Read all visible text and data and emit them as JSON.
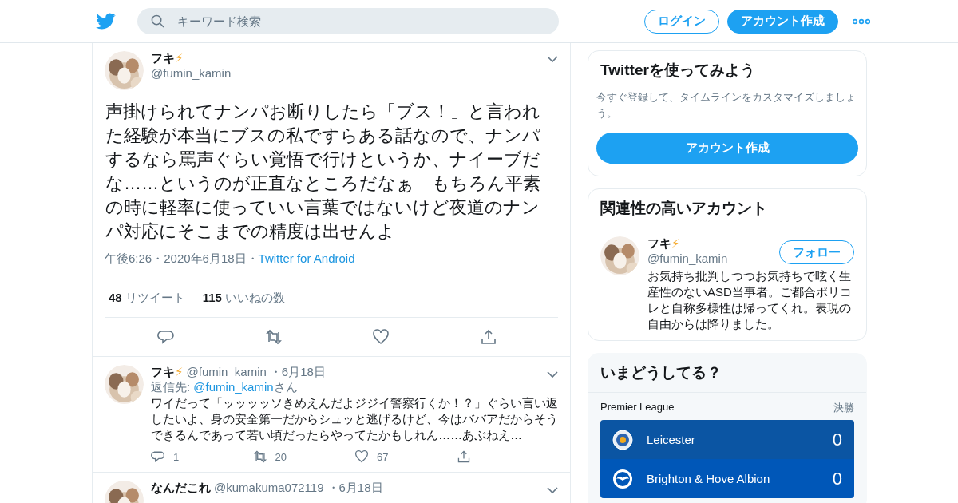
{
  "header": {
    "search": {
      "placeholder": "キーワード検索"
    },
    "buttons": [
      {
        "label": "ログイン",
        "kind": "outline"
      },
      {
        "label": "アカウント作成",
        "kind": "filled"
      }
    ]
  },
  "tweet": {
    "name": "フキ",
    "badge": "⚡",
    "handle": "@fumin_kamin",
    "text": "声掛けられてナンパお断りしたら「ブス！」と言われた経験が本当にブスの私ですらある話なので、ナンパするなら罵声ぐらい覚悟で行けというか、ナイーブだな……というのが正直なところだなぁ　もちろん平素の時に軽率に使っていい言葉ではないけど夜道のナンパ対応にそこまでの精度は出せんよ",
    "meta": [
      {
        "text": "午後6:26",
        "kind": "text",
        "sep": "・"
      },
      {
        "text": "2020年6月18日",
        "kind": "text",
        "sep": "・"
      },
      {
        "text": "Twitter for Android",
        "kind": "link"
      }
    ],
    "stats": [
      {
        "count": "48",
        "label": "リツイート"
      },
      {
        "count": "115",
        "label": "いいねの数"
      }
    ]
  },
  "replies": [
    {
      "name": "フキ",
      "badge": "⚡",
      "handle": "@fumin_kamin",
      "date": "・6月18日",
      "reply_prefix": "返信先:",
      "reply_to": "@fumin_kamin",
      "reply_suffix": "さん",
      "text": "ワイだって「ッッッッソきめえんだよジジイ警察行くか！？」ぐらい言い返したいよ、身の安全第一だからシュッと逃げるけど、今はババアだからそうできるんであって若い頃だったらやってたかもしれん……あぶねえ…",
      "counts": {
        "reply": "1",
        "retweet": "20",
        "like": "67"
      }
    },
    {
      "name": "なんだこれ",
      "handle": "@kumakuma072119",
      "date": "・6月18日"
    }
  ],
  "sidebar": {
    "signup": {
      "title": "Twitterを使ってみよう",
      "description": "今すぐ登録して、タイムラインをカスタマイズしましょう。",
      "button": "アカウント作成"
    },
    "related": {
      "title": "関連性の高いアカウント",
      "accounts": [
        {
          "name": "フキ",
          "badge": "⚡",
          "handle": "@fumin_kamin",
          "follow": "フォロー",
          "bio": "お気持ち批判しつつお気持ちで呟く生産性のないASD当事者。ご都合ポリコレと自称多様性は帰ってくれ。表現の自由からは降りました。"
        }
      ]
    },
    "trends": {
      "title": "いまどうしてる？",
      "league": "Premier League",
      "status": "決勝",
      "teams": [
        {
          "name": "Leicester",
          "score": "0",
          "kind": "fox"
        },
        {
          "name": "Brighton & Hove Albion",
          "score": "0",
          "kind": "gull"
        }
      ]
    }
  }
}
